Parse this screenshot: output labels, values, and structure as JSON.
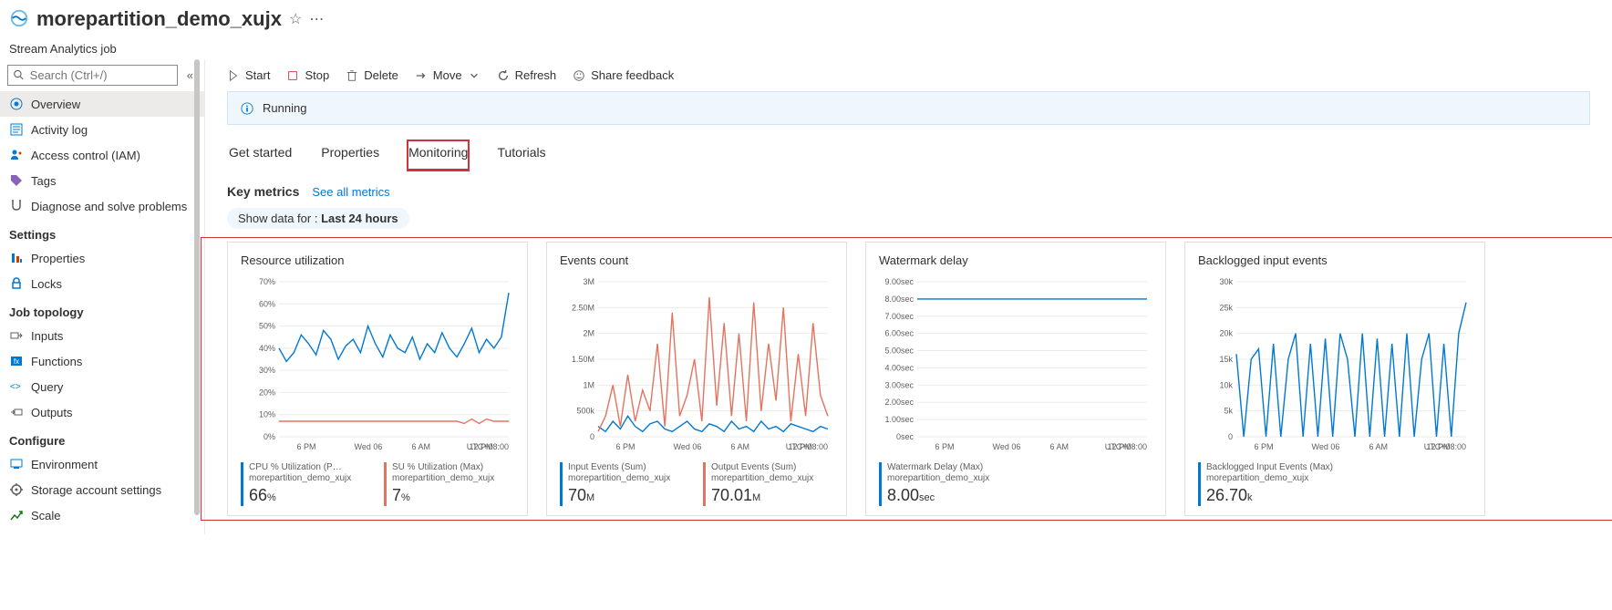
{
  "header": {
    "title": "morepartition_demo_xujx",
    "subtitle": "Stream Analytics job"
  },
  "search": {
    "placeholder": "Search (Ctrl+/)"
  },
  "nav": {
    "top": [
      {
        "label": "Overview"
      },
      {
        "label": "Activity log"
      },
      {
        "label": "Access control (IAM)"
      },
      {
        "label": "Tags"
      },
      {
        "label": "Diagnose and solve problems"
      }
    ],
    "settings_head": "Settings",
    "settings": [
      {
        "label": "Properties"
      },
      {
        "label": "Locks"
      }
    ],
    "topology_head": "Job topology",
    "topology": [
      {
        "label": "Inputs"
      },
      {
        "label": "Functions"
      },
      {
        "label": "Query"
      },
      {
        "label": "Outputs"
      }
    ],
    "configure_head": "Configure",
    "configure": [
      {
        "label": "Environment"
      },
      {
        "label": "Storage account settings"
      },
      {
        "label": "Scale"
      }
    ]
  },
  "toolbar": {
    "start": "Start",
    "stop": "Stop",
    "delete": "Delete",
    "move": "Move",
    "refresh": "Refresh",
    "feedback": "Share feedback"
  },
  "status": {
    "text": "Running"
  },
  "tabs": {
    "get_started": "Get started",
    "properties": "Properties",
    "monitoring": "Monitoring",
    "tutorials": "Tutorials"
  },
  "metrics": {
    "heading": "Key metrics",
    "see_all": "See all metrics",
    "show_data_label": "Show data for :",
    "show_data_value": "Last 24 hours"
  },
  "cards": {
    "resource": {
      "title": "Resource utilization",
      "legend1": {
        "name": "CPU % Utilization (P…",
        "sub": "morepartition_demo_xujx",
        "value": "66",
        "unit": "%",
        "color": "#0078d4"
      },
      "legend2": {
        "name": "SU % Utilization (Max)",
        "sub": "morepartition_demo_xujx",
        "value": "7",
        "unit": "%",
        "color": "#e3735e"
      }
    },
    "events": {
      "title": "Events count",
      "legend1": {
        "name": "Input Events (Sum)",
        "sub": "morepartition_demo_xujx",
        "value": "70",
        "unit": "M",
        "color": "#0078d4"
      },
      "legend2": {
        "name": "Output Events (Sum)",
        "sub": "morepartition_demo_xujx",
        "value": "70.01",
        "unit": "M",
        "color": "#e3735e"
      }
    },
    "watermark": {
      "title": "Watermark delay",
      "legend1": {
        "name": "Watermark Delay (Max)",
        "sub": "morepartition_demo_xujx",
        "value": "8.00",
        "unit": "sec",
        "color": "#0078d4"
      }
    },
    "backlog": {
      "title": "Backlogged input events",
      "legend1": {
        "name": "Backlogged Input Events (Max)",
        "sub": "morepartition_demo_xujx",
        "value": "26.70",
        "unit": "k",
        "color": "#0078d4"
      }
    }
  },
  "chart_data": [
    {
      "type": "line",
      "title": "Resource utilization",
      "x_ticks": [
        "6 PM",
        "Wed 06",
        "6 AM",
        "12 PM"
      ],
      "tz": "UTC+08:00",
      "ylim": [
        0,
        70
      ],
      "yunit": "%",
      "y_ticks": [
        "0%",
        "10%",
        "20%",
        "30%",
        "40%",
        "50%",
        "60%",
        "70%"
      ],
      "series": [
        {
          "name": "CPU % Utilization",
          "color": "#0078d4",
          "values": [
            40,
            34,
            38,
            46,
            42,
            37,
            48,
            44,
            35,
            41,
            44,
            38,
            50,
            42,
            36,
            46,
            40,
            38,
            45,
            35,
            42,
            38,
            47,
            40,
            36,
            42,
            49,
            38,
            44,
            40,
            45,
            65
          ]
        },
        {
          "name": "SU % Utilization",
          "color": "#e3735e",
          "values": [
            7,
            7,
            7,
            7,
            7,
            7,
            7,
            7,
            7,
            7,
            7,
            7,
            7,
            7,
            7,
            7,
            7,
            7,
            7,
            7,
            7,
            7,
            7,
            7,
            7,
            6,
            8,
            6,
            8,
            7,
            7,
            7
          ]
        }
      ]
    },
    {
      "type": "line",
      "title": "Events count",
      "x_ticks": [
        "6 PM",
        "Wed 06",
        "6 AM",
        "12 PM"
      ],
      "tz": "UTC+08:00",
      "ylim": [
        0,
        3000000
      ],
      "yunit": "",
      "y_ticks": [
        "0",
        "500k",
        "1M",
        "1.50M",
        "2M",
        "2.50M",
        "3M"
      ],
      "series": [
        {
          "name": "Input Events",
          "color": "#0078d4",
          "values": [
            200000,
            100000,
            300000,
            150000,
            400000,
            200000,
            100000,
            250000,
            300000,
            150000,
            100000,
            200000,
            300000,
            150000,
            100000,
            250000,
            200000,
            100000,
            300000,
            150000,
            200000,
            100000,
            300000,
            150000,
            200000,
            100000,
            250000,
            200000,
            150000,
            100000,
            200000,
            150000
          ]
        },
        {
          "name": "Output Events",
          "color": "#e3735e",
          "values": [
            100000,
            400000,
            1000000,
            200000,
            1200000,
            300000,
            900000,
            500000,
            1800000,
            200000,
            2400000,
            400000,
            800000,
            1500000,
            300000,
            2700000,
            600000,
            2200000,
            400000,
            2000000,
            300000,
            2600000,
            500000,
            1800000,
            700000,
            2500000,
            300000,
            1600000,
            400000,
            2200000,
            800000,
            400000
          ]
        }
      ]
    },
    {
      "type": "line",
      "title": "Watermark delay",
      "x_ticks": [
        "6 PM",
        "Wed 06",
        "6 AM",
        "12 PM"
      ],
      "tz": "UTC+08:00",
      "ylim": [
        0,
        9
      ],
      "yunit": "sec",
      "y_ticks": [
        "0sec",
        "1.00sec",
        "2.00sec",
        "3.00sec",
        "4.00sec",
        "5.00sec",
        "6.00sec",
        "7.00sec",
        "8.00sec",
        "9.00sec"
      ],
      "series": [
        {
          "name": "Watermark Delay",
          "color": "#0078d4",
          "values": [
            8,
            8,
            8,
            8,
            8,
            8,
            8,
            8,
            8,
            8,
            8,
            8,
            8,
            8,
            8,
            8,
            8,
            8,
            8,
            8,
            8,
            8,
            8,
            8,
            8,
            8,
            8,
            8,
            8,
            8,
            8,
            8
          ]
        }
      ]
    },
    {
      "type": "line",
      "title": "Backlogged input events",
      "x_ticks": [
        "6 PM",
        "Wed 06",
        "6 AM",
        "12 PM"
      ],
      "tz": "UTC+08:00",
      "ylim": [
        0,
        30000
      ],
      "yunit": "",
      "y_ticks": [
        "0",
        "5k",
        "10k",
        "15k",
        "20k",
        "25k",
        "30k"
      ],
      "series": [
        {
          "name": "Backlogged Input Events",
          "color": "#0078d4",
          "values": [
            16000,
            0,
            15000,
            17000,
            0,
            18000,
            0,
            15000,
            20000,
            0,
            18000,
            0,
            19000,
            0,
            20000,
            15000,
            0,
            20000,
            0,
            19000,
            0,
            18000,
            0,
            20000,
            0,
            15000,
            20000,
            0,
            18000,
            0,
            20000,
            26000
          ]
        }
      ]
    }
  ]
}
